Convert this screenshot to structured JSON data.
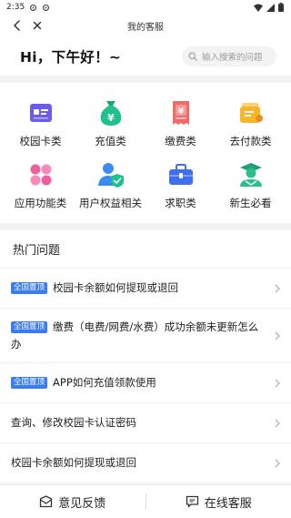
{
  "status_bar": {
    "time": "2:35"
  },
  "nav": {
    "title": "我的客服"
  },
  "greeting": "Hi，下午好！~",
  "search": {
    "placeholder": "输入搜索的问题"
  },
  "categories": [
    {
      "label": "校园卡类",
      "icon": "campus-card-icon",
      "color": "#6b5de8"
    },
    {
      "label": "充值类",
      "icon": "money-bag-icon",
      "color": "#1fc08a"
    },
    {
      "label": "缴费类",
      "icon": "bill-icon",
      "color": "#f06a6a"
    },
    {
      "label": "去付款类",
      "icon": "wallet-icon",
      "color": "#f5b62a"
    },
    {
      "label": "应用功能类",
      "icon": "apps-icon",
      "color": "#f25fa0"
    },
    {
      "label": "用户权益相关",
      "icon": "user-shield-icon",
      "color": "#3d8bf0"
    },
    {
      "label": "求职类",
      "icon": "briefcase-icon",
      "color": "#3f6ff0"
    },
    {
      "label": "新生必看",
      "icon": "student-icon",
      "color": "#2bbf8b"
    }
  ],
  "faq": {
    "title": "热门问题",
    "badge": "全国置顶",
    "items": [
      {
        "text": "校园卡余额如何提现或退回",
        "pinned": true
      },
      {
        "text": "缴费（电费/网费/水费）成功余额未更新怎么办",
        "pinned": true
      },
      {
        "text": "APP如何充值领款使用",
        "pinned": true
      },
      {
        "text": "查询、修改校园卡认证密码",
        "pinned": false
      },
      {
        "text": "校园卡余额如何提现或退回",
        "pinned": false
      }
    ]
  },
  "bottom": {
    "feedback": "意见反馈",
    "online_service": "在线客服"
  },
  "colors": {
    "accent": "#3b7cf6"
  }
}
